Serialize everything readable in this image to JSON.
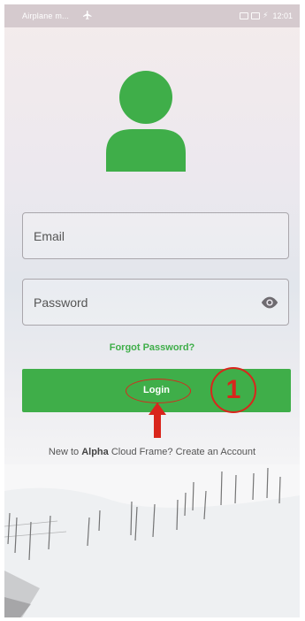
{
  "status_bar": {
    "left_text": "Airplane m...",
    "time": "12:01"
  },
  "login_form": {
    "email_placeholder": "Email",
    "password_placeholder": "Password",
    "forgot_password": "Forgot Password?",
    "login_button": "Login"
  },
  "signup": {
    "prefix": "New to",
    "brand": "Alpha",
    "app_name": "Cloud Frame?",
    "link": "Create an Account"
  },
  "annotation": {
    "step_number": "1"
  },
  "colors": {
    "accent": "#3fae49",
    "annotation": "#d9261c"
  },
  "icons": [
    "airplane-icon",
    "user-avatar-icon",
    "eye-icon",
    "arrow-up-icon"
  ]
}
